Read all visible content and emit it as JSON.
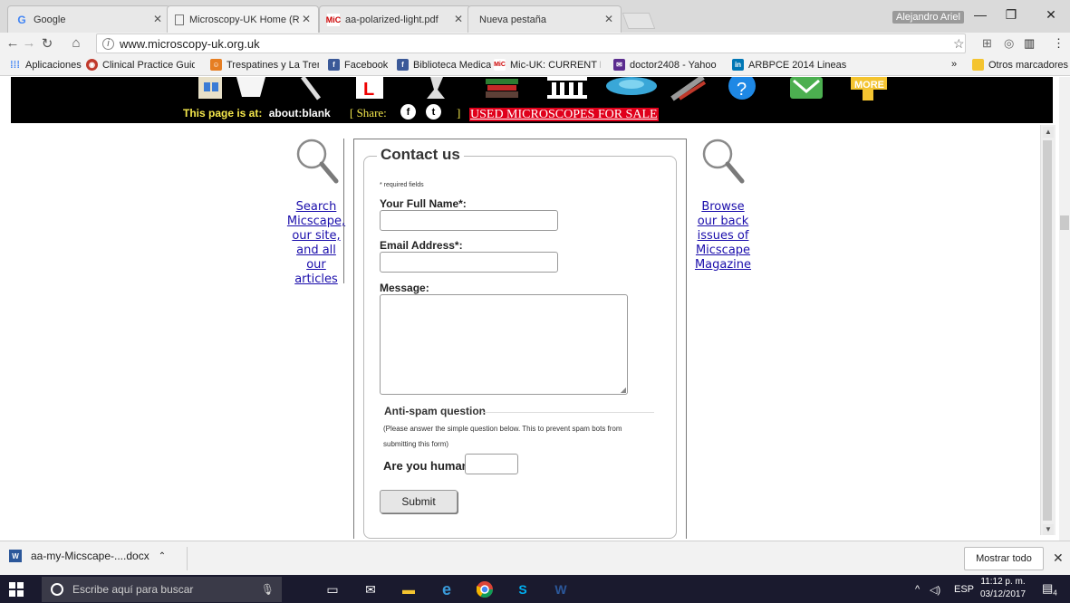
{
  "browser": {
    "tabs": [
      {
        "label": "Google",
        "favicon": "google-icon"
      },
      {
        "label": "Microscopy-UK Home (R",
        "favicon": "page-icon"
      },
      {
        "label": "aa-polarized-light.pdf",
        "favicon": "micuk-icon"
      },
      {
        "label": "Nueva pestaña",
        "favicon": "none"
      }
    ],
    "user": "Alejandro Ariel",
    "url": "www.microscopy-uk.org.uk",
    "bookmarks": [
      {
        "label": "Aplicaciones",
        "icon": "apps-icon"
      },
      {
        "label": "Clinical Practice Guid",
        "icon": "clinical-icon"
      },
      {
        "label": "Trespatines y La Trem",
        "icon": "trespatines-icon"
      },
      {
        "label": "Facebook",
        "icon": "facebook-icon"
      },
      {
        "label": "Biblioteca Medica",
        "icon": "facebook-icon"
      },
      {
        "label": "Mic-UK: CURRENT IS",
        "icon": "micuk-icon"
      },
      {
        "label": "doctor2408 - Yahoo",
        "icon": "mail-icon"
      },
      {
        "label": "ARBPCE 2014 Lineas",
        "icon": "linkedin-icon"
      }
    ],
    "bookmarks_more": "»",
    "other_bookmarks": "Otros marcadores"
  },
  "page": {
    "page_is_at_label": "This page is at:",
    "page_is_at_value": "about:blank",
    "share_label": "[ Share:",
    "share_close": "]",
    "used_microscopes": "USED MICROSCOPES FOR SALE",
    "more_label": "MORE",
    "search_link": [
      "Search",
      "Micscape,",
      "our site,",
      "and all",
      "our",
      "articles"
    ],
    "browse_link": [
      "Browse",
      "our back",
      "issues of",
      "Micscape",
      "Magazine"
    ],
    "form": {
      "title": "Contact us",
      "required_note": "* required fields",
      "name_label": "Your Full Name*:",
      "email_label": "Email Address*:",
      "message_label": "Message:",
      "antispam_title": "Anti-spam question",
      "antispam_text": "(Please answer the simple question below. This to prevent spam bots from submitting this form)",
      "human_label": "Are you human?",
      "submit_label": "Submit"
    }
  },
  "download_bar": {
    "file": "aa-my-Micscape-....docx",
    "show_all": "Mostrar todo"
  },
  "taskbar": {
    "search_placeholder": "Escribe aquí para buscar",
    "lang": "ESP",
    "time": "11:12 p. m.",
    "date": "03/12/2017",
    "notifications": "4"
  },
  "colors": {
    "black_band": "#000000",
    "yellow_text": "#f5e84c",
    "used_bg": "#e0001b",
    "link": "#1a0dab"
  }
}
